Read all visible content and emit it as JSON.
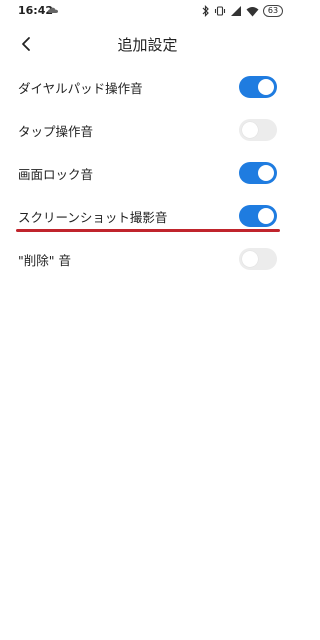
{
  "status_bar": {
    "time": "16:42",
    "battery": "63",
    "icons": [
      "cloud-icon",
      "bluetooth-icon",
      "vibrate-icon",
      "signal-icon",
      "wifi-icon",
      "battery-icon"
    ]
  },
  "header": {
    "title": "追加設定",
    "back_icon": "chevron-left-icon"
  },
  "settings": [
    {
      "label": "ダイヤルパッド操作音",
      "enabled": true
    },
    {
      "label": "タップ操作音",
      "enabled": false
    },
    {
      "label": "画面ロック音",
      "enabled": true
    },
    {
      "label": "スクリーンショット撮影音",
      "enabled": true
    },
    {
      "label": "\"削除\" 音",
      "enabled": false
    }
  ],
  "colors": {
    "toggle_on": "#1f7ce0",
    "toggle_off": "#ececec",
    "highlight": "#c0242c"
  }
}
